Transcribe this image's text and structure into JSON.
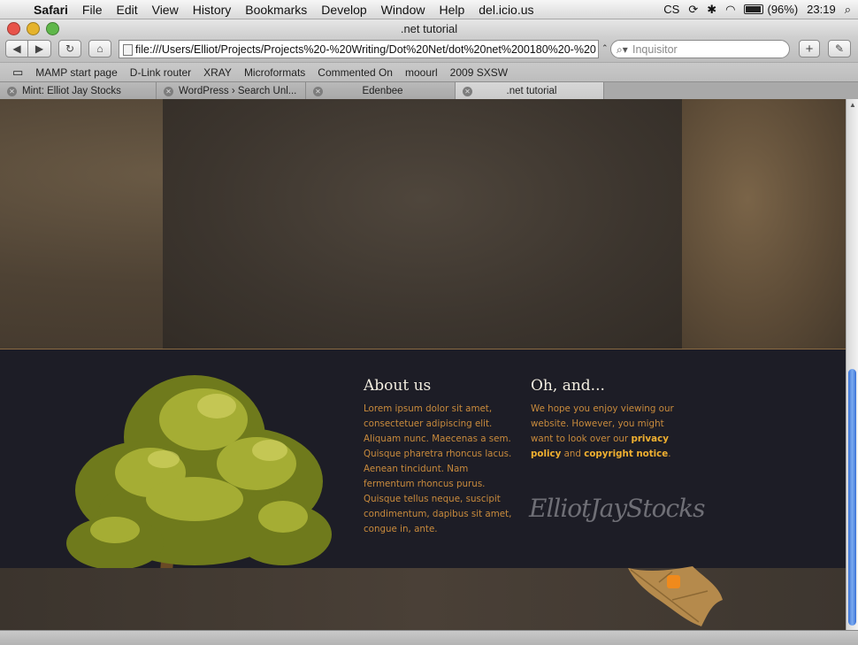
{
  "menubar": {
    "app": "Safari",
    "items": [
      "File",
      "Edit",
      "View",
      "History",
      "Bookmarks",
      "Develop",
      "Window",
      "Help",
      "del.icio.us"
    ],
    "battery": "(96%)",
    "clock": "23:19",
    "icons": [
      "cs-icon",
      "sync-icon",
      "bluetooth-icon",
      "wifi-icon",
      "battery-icon",
      "spotlight-icon"
    ]
  },
  "window": {
    "title": ".net tutorial"
  },
  "toolbar": {
    "url": "file:///Users/Elliot/Projects/Projects%20-%20Writing/Dot%20Net/dot%20net%200180%20-%20",
    "search_placeholder": "Inquisitor"
  },
  "bookmarks": [
    "MAMP start page",
    "D-Link router",
    "XRAY",
    "Microformats",
    "Commented On",
    "moourl",
    "2009 SXSW"
  ],
  "tabs": [
    {
      "label": "Mint: Elliot Jay Stocks",
      "active": false
    },
    {
      "label": "WordPress › Search Unl...",
      "active": false
    },
    {
      "label": "Edenbee",
      "active": false
    },
    {
      "label": ".net tutorial",
      "active": true
    }
  ],
  "footer": {
    "about": {
      "title": "About us",
      "body": "Lorem ipsum dolor sit amet, consectetuer adipiscing elit. Aliquam nunc. Maecenas a sem. Quisque pharetra rhoncus lacus. Aenean tincidunt. Nam fermentum rhoncus purus. Quisque tellus neque, suscipit condimentum, dapibus sit amet, congue in, ante."
    },
    "oh_and": {
      "title": "Oh, and...",
      "body_before": "We hope you enjoy viewing our website. However, you might want to look over our ",
      "privacy_link": "privacy policy",
      "middle": " and ",
      "copyright_link": "copyright notice",
      "after": "."
    },
    "signature": "ElliotJayStocks"
  },
  "colors": {
    "footer_bg": "#1d1d26",
    "heading": "#f2ede0",
    "body_text": "#c88a3c",
    "link": "#f0b030",
    "rss": "#f08a1c"
  }
}
